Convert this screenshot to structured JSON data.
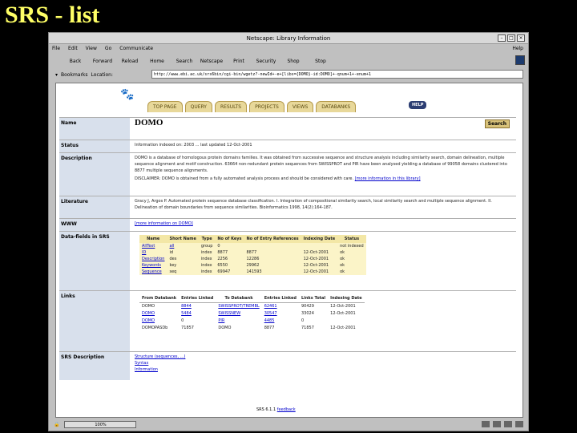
{
  "slide_title": "SRS - list",
  "window": {
    "title": "Netscape: Library Information",
    "menu": [
      "File",
      "Edit",
      "View",
      "Go",
      "Communicate"
    ],
    "menu_help": "Help",
    "toolbar": [
      "Back",
      "Forward",
      "Reload",
      "Home",
      "Search",
      "Netscape",
      "Print",
      "Security",
      "Shop",
      "Stop"
    ],
    "bookmarks_label": "Bookmarks",
    "location_label": "Location:",
    "url": "http://www.ebi.ac.uk/srs6bin/cgi-bin/wgetz?-newId+-e+[libs={DOMO}-id:DOMO]+-qnum+1+-enum+1",
    "status_progress": "100%"
  },
  "tabs": [
    "TOP PAGE",
    "QUERY",
    "RESULTS",
    "PROJECTS",
    "VIEWS",
    "DATABANKS"
  ],
  "help_label": "HELP",
  "fields": {
    "name_label": "Name",
    "name_value": "DOMO",
    "search_label": "Search",
    "status_label": "Status",
    "status_value": "Information indexed on: 2003 ... last updated 12-Oct-2001",
    "description_label": "Description",
    "description_p1": "DOMO is a database of homologous protein domains families. It was obtained from successive sequence and structure analysis including similarity search, domain delineation, multiple sequence alignment and motif construction. 63664 non-redundant protein sequences from SWISSPROT and PIR have been analysed yielding a database of 99058 domains clustered into 8877 multiple sequence alignments.",
    "description_p2": "DISCLAIMER: DOMO is obtained from a fully automated analysis process and should be considered with care.",
    "description_more": "[more information in this library]",
    "literature_label": "Literature",
    "literature_value": "Gracy J, Argos P. Automated protein sequence database classification. I. Integration of compositional similarity search, local similarity search and multiple sequence alignment. II. Delineation of domain boundaries from sequence similarities. Bioinformatics 1998, 14(2):164-187.",
    "www_label": "WWW",
    "www_value": "[more information on DOMO]",
    "datafields_label": "Data-fields in SRS",
    "links_label": "Links",
    "srsdesc_label": "SRS Description",
    "srsdesc_items": [
      "Structure (sequences, ...)",
      "Syntax",
      "Information"
    ]
  },
  "datafields": {
    "headers": [
      "Name",
      "Short Name",
      "Type",
      "No of Keys",
      "No of Entry References",
      "Indexing Date",
      "Status"
    ],
    "rows": [
      [
        "AllText",
        "all",
        "group",
        "0",
        "",
        "",
        "not indexed"
      ],
      [
        "ID",
        "id",
        "index",
        "8877",
        "8877",
        "12-Oct-2001",
        "ok"
      ],
      [
        "Description",
        "des",
        "index",
        "2256",
        "12286",
        "12-Oct-2001",
        "ok"
      ],
      [
        "Keywords",
        "key",
        "index",
        "6550",
        "29962",
        "12-Oct-2001",
        "ok"
      ],
      [
        "Sequence",
        "seq",
        "index",
        "69947",
        "141593",
        "12-Oct-2001",
        "ok"
      ]
    ]
  },
  "links": {
    "headers": [
      "From Databank",
      "Entries Linked",
      "To Databank",
      "Entries Linked",
      "Links Total",
      "Indexing Date"
    ],
    "rows": [
      [
        "DOMO",
        "8844",
        "SWISSPROT/TREMBL",
        "62461",
        "90429",
        "12-Oct-2001"
      ],
      [
        "DOMO",
        "5484",
        "SWISSNEW",
        "30547",
        "33024",
        "12-Oct-2001"
      ],
      [
        "DOMO",
        "0",
        "PIR",
        "4485",
        "0",
        ""
      ],
      [
        "DOMOPASDb",
        "71857",
        "DOMO",
        "8877",
        "71857",
        "12-Oct-2001"
      ]
    ]
  },
  "footer": "SRS 6.1.1",
  "footer_link": "feedback"
}
